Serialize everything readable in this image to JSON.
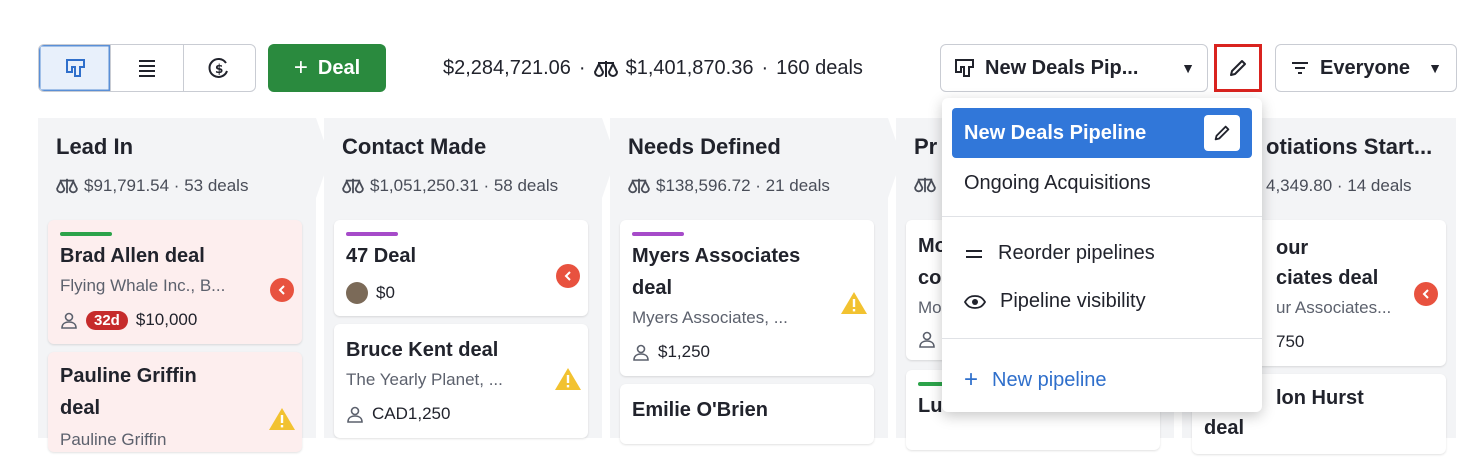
{
  "toolbar": {
    "views": [
      "pipeline-view",
      "list-view",
      "forecast-view"
    ],
    "add_deal_label": "Deal",
    "total_value": "$2,284,721.06",
    "weighted_value": "$1,401,870.36",
    "deal_count": "160 deals",
    "separator": "·",
    "pipeline_selected": "New Deals Pip...",
    "owner_filter": "Everyone"
  },
  "colors": {
    "accent": "#3177d9",
    "green": "#2a8a3e",
    "rot": "#e8523f"
  },
  "stages": [
    {
      "title": "Lead In",
      "meta": "$91,791.54 · 53 deals",
      "cards": [
        {
          "title": "Brad Allen deal",
          "sub": "Flying Whale Inc., B...",
          "days": "32d",
          "value": "$10,000"
        },
        {
          "title_l1": "Pauline Griffin",
          "title_l2": "deal",
          "sub": "Pauline Griffin"
        }
      ]
    },
    {
      "title": "Contact Made",
      "meta": "$1,051,250.31 · 58 deals",
      "cards": [
        {
          "title": "47 Deal",
          "value": "$0"
        },
        {
          "title": "Bruce Kent deal",
          "sub": "The Yearly Planet, ...",
          "value": "CAD1,250"
        }
      ]
    },
    {
      "title": "Needs Defined",
      "meta": "$138,596.72 · 21 deals",
      "cards": [
        {
          "title_l1": "Myers Associates",
          "title_l2": "deal",
          "sub": "Myers Associates, ...",
          "value": "$1,250"
        },
        {
          "title": "Emilie O'Brien"
        }
      ]
    },
    {
      "title": "Pr",
      "meta": "",
      "cards": [
        {
          "title_l1": "Mo",
          "title_l2": "co",
          "sub": "Mo"
        },
        {
          "title": "Lu"
        }
      ]
    },
    {
      "title": "otiations Start...",
      "meta": "4,349.80 · 14 deals",
      "cards": [
        {
          "title_l1": "our",
          "title_l2": "ciates deal",
          "sub": "ur Associates...",
          "value": "750"
        },
        {
          "title_l1": "lon Hurst",
          "title_l2": "deal"
        }
      ]
    }
  ],
  "dropdown": {
    "selected": "New Deals Pipeline",
    "items": [
      "Ongoing Acquisitions"
    ],
    "actions": [
      "Reorder pipelines",
      "Pipeline visibility"
    ],
    "new_pipeline": "New pipeline"
  }
}
